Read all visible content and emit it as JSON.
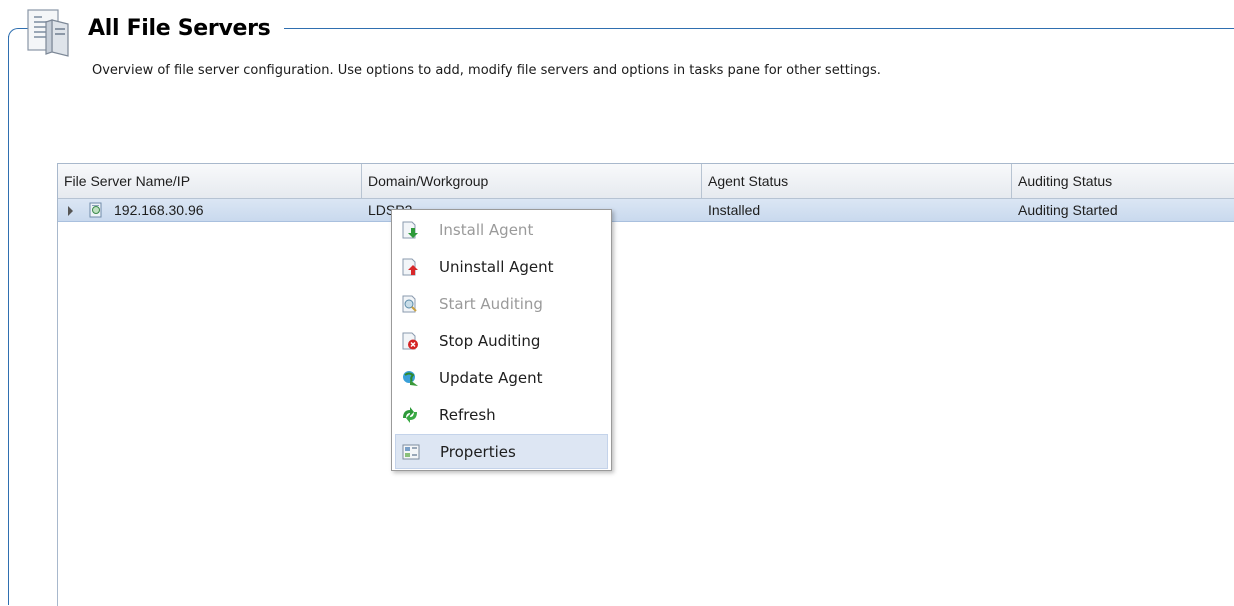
{
  "header": {
    "title": "All File Servers",
    "description": "Overview of file server configuration. Use options to add, modify file servers and options in tasks pane for other settings.",
    "icon": "server-document-icon"
  },
  "grid": {
    "columns": [
      "File Server Name/IP",
      "Domain/Workgroup",
      "Agent Status",
      "Auditing Status"
    ],
    "rows": [
      {
        "name": "192.168.30.96",
        "domain": "LDSP2",
        "agent_status": "Installed",
        "auditing_status": "Auditing Started",
        "icon": "file-server-icon",
        "selected": true
      }
    ]
  },
  "context_menu": {
    "items": [
      {
        "label": "Install Agent",
        "icon": "install-agent-icon",
        "enabled": false
      },
      {
        "label": "Uninstall Agent",
        "icon": "uninstall-agent-icon",
        "enabled": true
      },
      {
        "label": "Start Auditing",
        "icon": "start-auditing-icon",
        "enabled": false
      },
      {
        "label": "Stop Auditing",
        "icon": "stop-auditing-icon",
        "enabled": true
      },
      {
        "label": "Update Agent",
        "icon": "update-agent-icon",
        "enabled": true
      },
      {
        "label": "Refresh",
        "icon": "refresh-icon",
        "enabled": true
      },
      {
        "label": "Properties",
        "icon": "properties-icon",
        "enabled": true,
        "highlighted": true
      }
    ]
  },
  "colors": {
    "frame": "#2f6fb0",
    "selected_row": "#cfdcef",
    "menu_highlight": "#dde6f3"
  }
}
